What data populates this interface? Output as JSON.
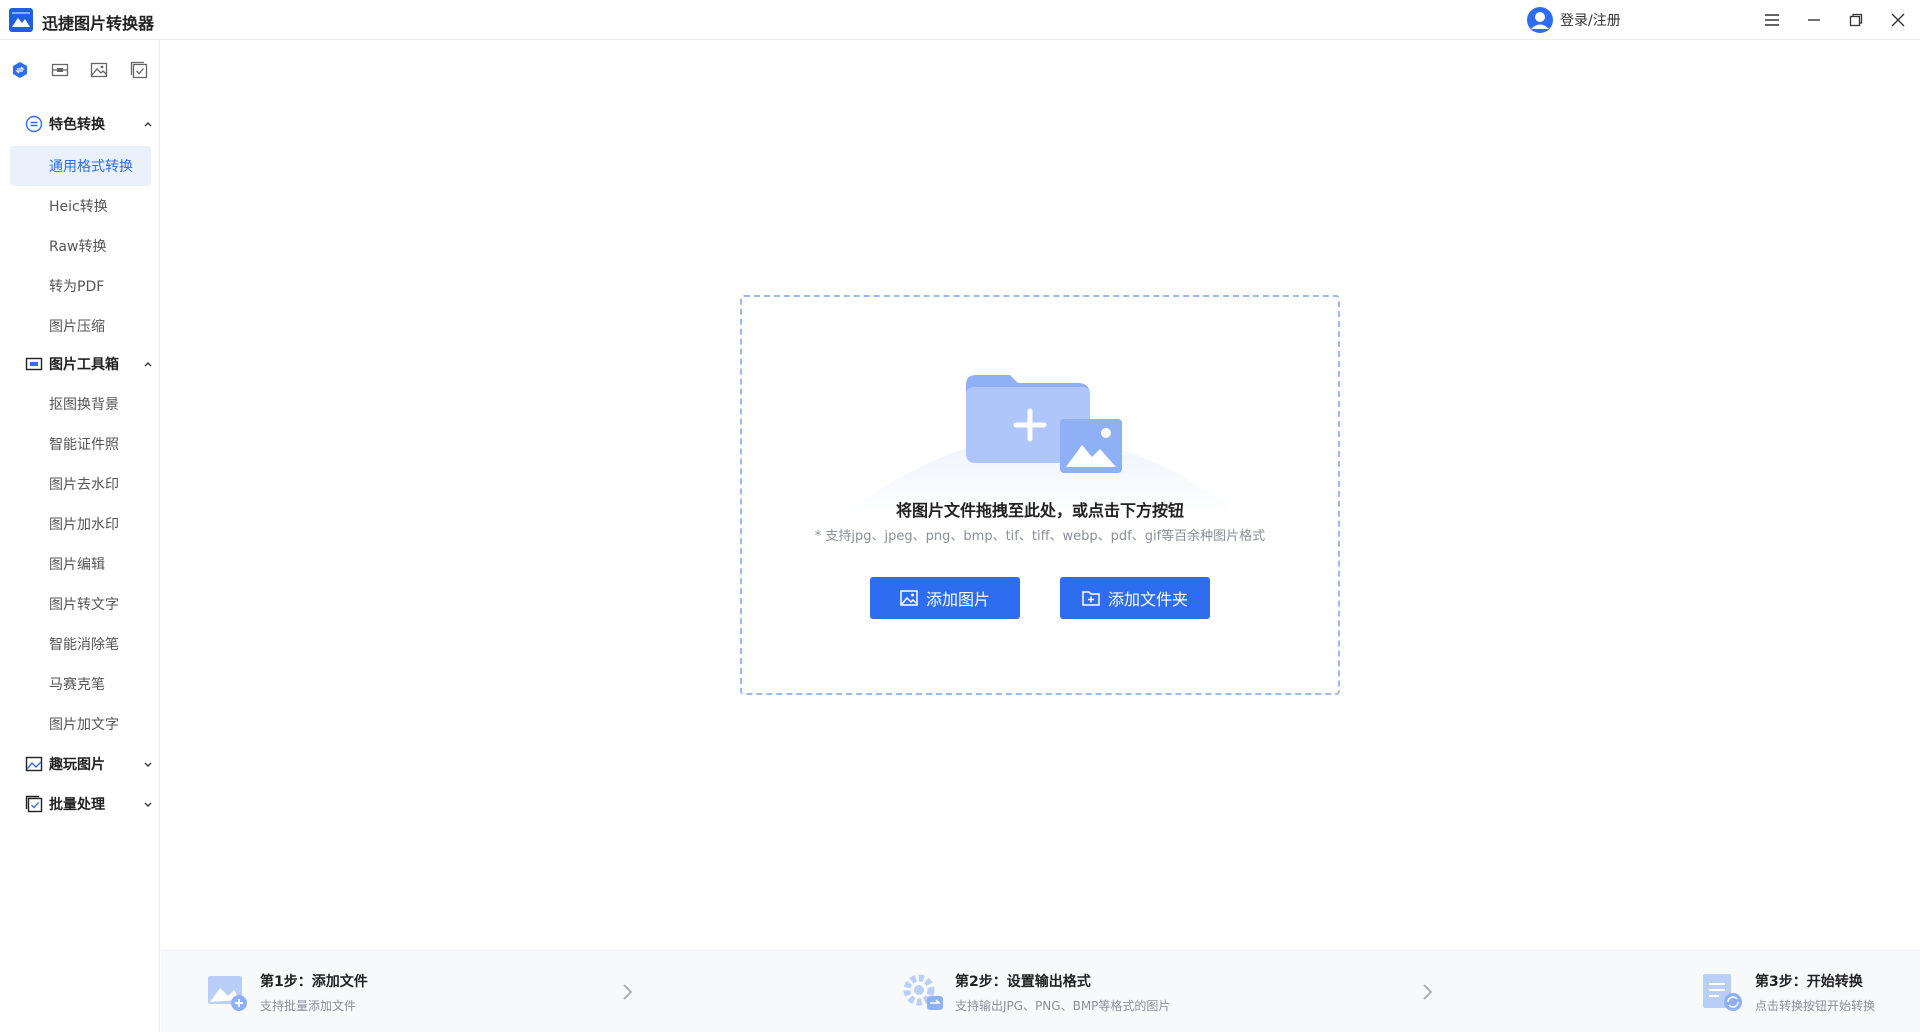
{
  "app": {
    "title": "迅捷图片转换器"
  },
  "header": {
    "login_label": "登录/注册"
  },
  "sidebar": {
    "sections": [
      {
        "label": "特色转换",
        "expanded": true,
        "items": [
          "通用格式转换",
          "Heic转换",
          "Raw转换",
          "转为PDF",
          "图片压缩"
        ]
      },
      {
        "label": "图片工具箱",
        "expanded": true,
        "items": [
          "抠图换背景",
          "智能证件照",
          "图片去水印",
          "图片加水印",
          "图片编辑",
          "图片转文字",
          "智能消除笔",
          "马赛克笔",
          "图片加文字"
        ]
      },
      {
        "label": "趣玩图片",
        "expanded": false,
        "items": []
      },
      {
        "label": "批量处理",
        "expanded": false,
        "items": []
      }
    ],
    "active_item": "通用格式转换"
  },
  "dropzone": {
    "title": "将图片文件拖拽至此处，或点击下方按钮",
    "hint": "* 支持jpg、jpeg、png、bmp、tif、tiff、webp、pdf、gif等百余种图片格式",
    "add_image_label": "添加图片",
    "add_folder_label": "添加文件夹"
  },
  "steps": [
    {
      "title": "第1步：添加文件",
      "subtitle": "支持批量添加文件"
    },
    {
      "title": "第2步：设置输出格式",
      "subtitle": "支持输出JPG、PNG、BMP等格式的图片"
    },
    {
      "title": "第3步：开始转换",
      "subtitle": "点击转换按钮开始转换"
    }
  ],
  "colors": {
    "accent": "#2f6df0",
    "active_bg": "#eaf1fd",
    "dashed_border": "#9dbaf0"
  }
}
